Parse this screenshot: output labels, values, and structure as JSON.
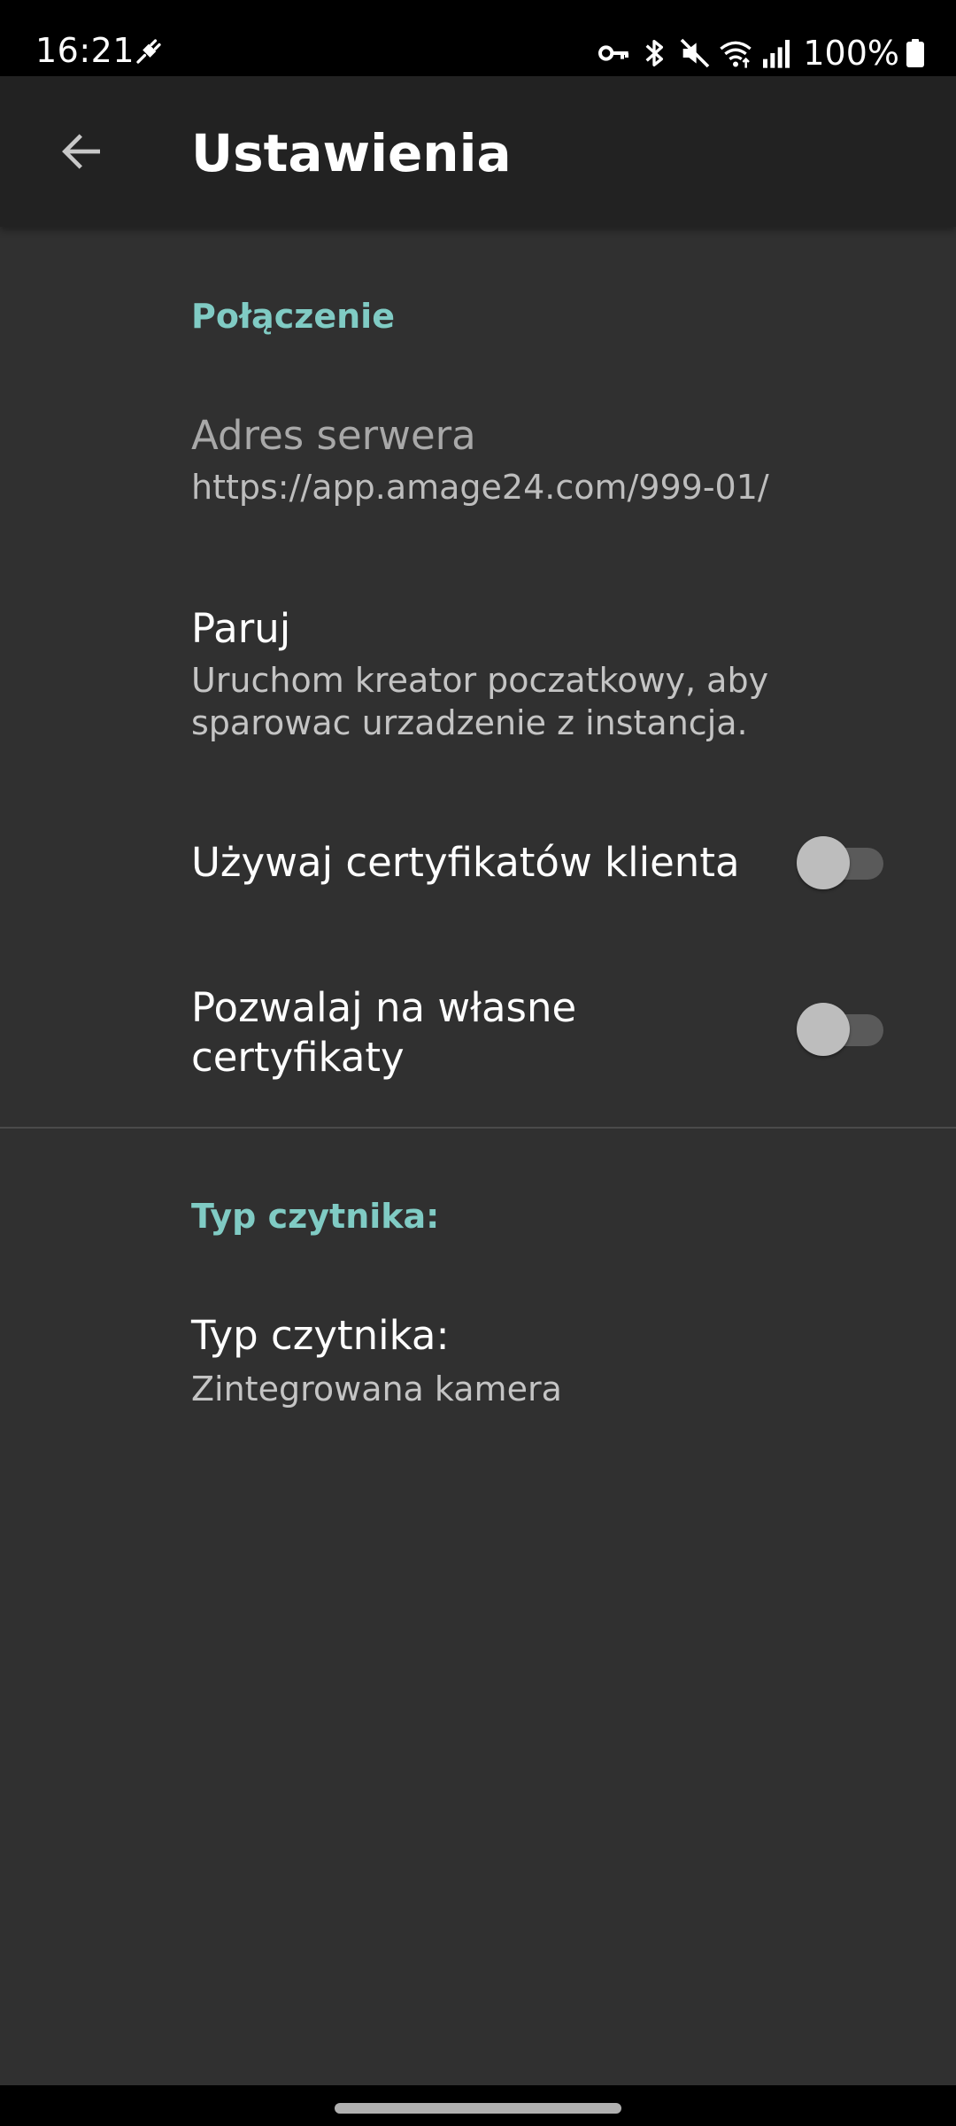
{
  "status_bar": {
    "time": "16:21",
    "battery_text": "100%",
    "icons": [
      "usb-debug-icon",
      "vpn-key-icon",
      "bluetooth-icon",
      "mute-icon",
      "wifi-icon",
      "signal-icon",
      "battery-icon"
    ]
  },
  "app_bar": {
    "title": "Ustawienia",
    "back_icon": "arrow-back-icon"
  },
  "sections": {
    "connection": {
      "header": "Połączenie",
      "server_address": {
        "title": "Adres serwera",
        "summary": "https://app.amage24.com/999-01/"
      },
      "pair": {
        "title": "Paruj",
        "summary": "Uruchom kreator poczatkowy, aby sparowac urzadzenie z instancja."
      },
      "client_certificates": {
        "title": "Używaj certyfikatów klienta",
        "enabled": false
      },
      "custom_certificates": {
        "title": "Pozwalaj na własne certyfikaty",
        "enabled": false
      }
    },
    "reader": {
      "header": "Typ czytnika:",
      "reader_type": {
        "title": "Typ czytnika:",
        "summary": "Zintegrowana kamera"
      }
    }
  },
  "colors": {
    "background": "#303030",
    "app_bar": "#222222",
    "accent": "#80cbc4",
    "switch_thumb_off": "#bdbdbd",
    "switch_track_off": "#5a5a5a"
  }
}
